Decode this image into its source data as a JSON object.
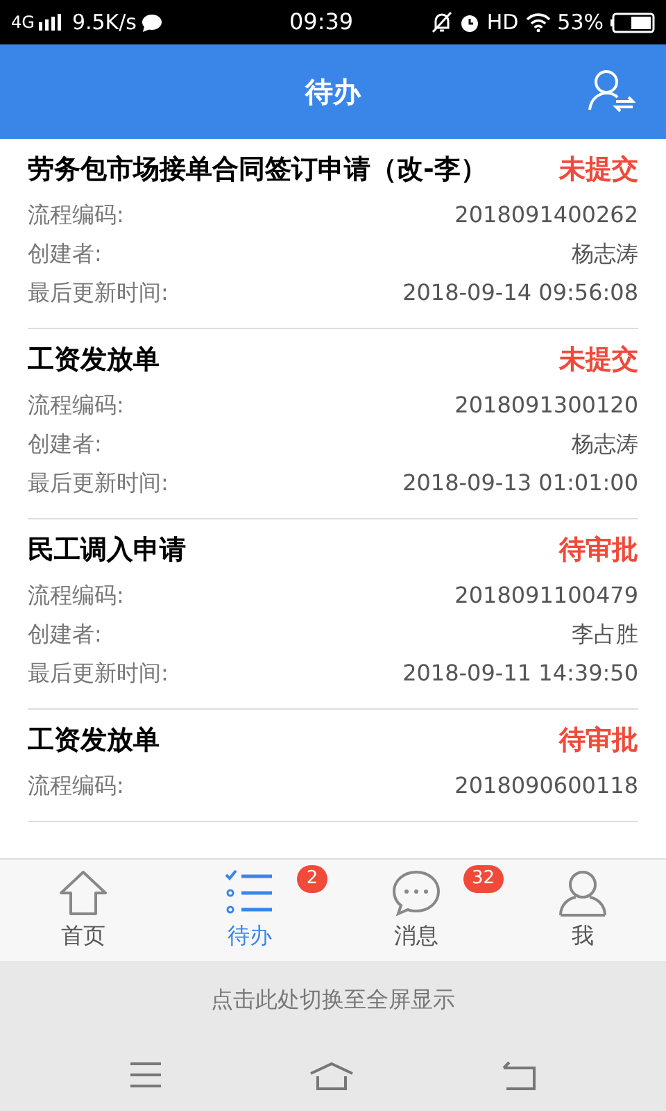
{
  "status_bar": {
    "network": "4G",
    "speed": "9.5K/s",
    "time": "09:39",
    "hd": "HD",
    "battery": "53%"
  },
  "header": {
    "title": "待办"
  },
  "items": [
    {
      "title": "劳务包市场接单合同签订申请（改-李）",
      "status": "未提交",
      "fields": [
        {
          "label": "流程编码:",
          "value": "2018091400262"
        },
        {
          "label": "创建者:",
          "value": "杨志涛"
        },
        {
          "label": "最后更新时间:",
          "value": "2018-09-14 09:56:08"
        }
      ]
    },
    {
      "title": "工资发放单",
      "status": "未提交",
      "fields": [
        {
          "label": "流程编码:",
          "value": "2018091300120"
        },
        {
          "label": "创建者:",
          "value": "杨志涛"
        },
        {
          "label": "最后更新时间:",
          "value": "2018-09-13 01:01:00"
        }
      ]
    },
    {
      "title": "民工调入申请",
      "status": "待审批",
      "fields": [
        {
          "label": "流程编码:",
          "value": "2018091100479"
        },
        {
          "label": "创建者:",
          "value": "李占胜"
        },
        {
          "label": "最后更新时间:",
          "value": "2018-09-11 14:39:50"
        }
      ]
    },
    {
      "title": "工资发放单",
      "status": "待审批",
      "fields": [
        {
          "label": "流程编码:",
          "value": "2018090600118"
        }
      ]
    }
  ],
  "tabs": [
    {
      "kind": "home",
      "label": "首页",
      "selected": false
    },
    {
      "kind": "todo",
      "label": "待办",
      "selected": true,
      "badge": "2"
    },
    {
      "kind": "messages",
      "label": "消息",
      "selected": false,
      "badge": "32"
    },
    {
      "kind": "me",
      "label": "我",
      "selected": false
    }
  ],
  "fullscreen_hint": "点击此处切换至全屏显示"
}
